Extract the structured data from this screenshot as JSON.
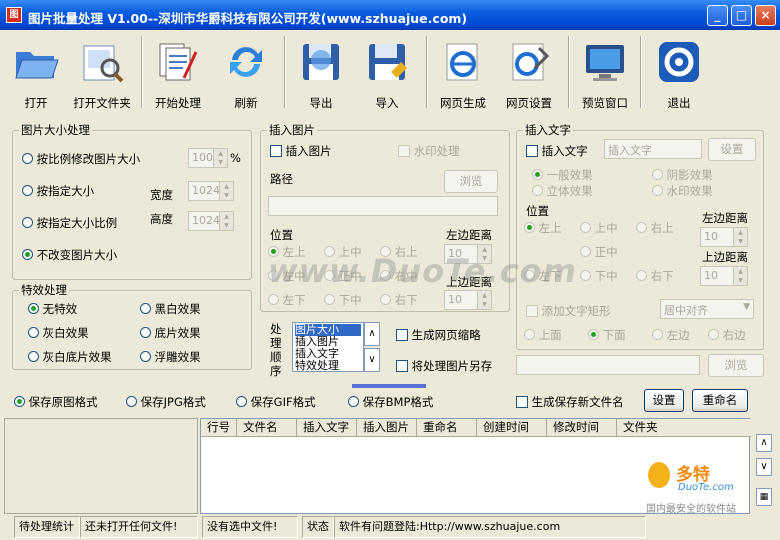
{
  "window": {
    "title": "图片批量处理 V1.00--深圳市华爵科技有限公司开发(www.szhuajue.com)",
    "min": "_",
    "max": "□",
    "close": "×"
  },
  "toolbar": [
    {
      "label": "打开",
      "icon": "open-folder-icon"
    },
    {
      "label": "打开文件夹",
      "icon": "folder-magnifier-icon"
    },
    {
      "label": "开始处理",
      "icon": "process-docs-icon"
    },
    {
      "label": "刷新",
      "icon": "refresh-icon"
    },
    {
      "label": "导出",
      "icon": "floppy-export-icon"
    },
    {
      "label": "导入",
      "icon": "floppy-import-icon"
    },
    {
      "label": "网页生成",
      "icon": "ie-globe-icon"
    },
    {
      "label": "网页设置",
      "icon": "ie-page-icon"
    },
    {
      "label": "预览窗口",
      "icon": "monitor-icon"
    },
    {
      "label": "退出",
      "icon": "exit-icon"
    }
  ],
  "size": {
    "legend": "图片大小处理",
    "opt_ratio": "按比例修改图片大小",
    "ratio_value": "100",
    "pct": "%",
    "opt_size": "按指定大小",
    "width_label": "宽度",
    "width_value": "1024",
    "opt_size_ratio": "按指定大小比例",
    "height_label": "高度",
    "height_value": "1024",
    "opt_keep": "不改变图片大小"
  },
  "effects": {
    "legend": "特效处理",
    "items": [
      "无特效",
      "黑白效果",
      "灰白效果",
      "底片效果",
      "灰白底片效果",
      "浮雕效果"
    ]
  },
  "insert_image": {
    "legend": "插入图片",
    "check_label": "插入图片",
    "watermark_label": "水印处理",
    "path_label": "路径",
    "browse": "浏览",
    "position_label": "位置",
    "pos": [
      "左上",
      "上中",
      "右上",
      "左中",
      "正中",
      "右中",
      "左下",
      "下中",
      "右下"
    ],
    "left_label": "左边距离",
    "left_value": "10",
    "top_label": "上边距离",
    "top_value": "10"
  },
  "insert_text": {
    "legend": "插入文字",
    "check_label": "插入文字",
    "placeholder": "插入文字",
    "settings": "设置",
    "effects": [
      "一般效果",
      "阴影效果",
      "立体效果",
      "水印效果"
    ],
    "position_label": "位置",
    "pos": [
      "左上",
      "上中",
      "右上",
      "正中",
      "左下",
      "下中",
      "右下"
    ],
    "left_label": "左边距离",
    "left_value": "10",
    "top_label": "上边距离",
    "top_value": "10",
    "rect_label": "添加文字矩形",
    "align_value": "居中对齐",
    "rect_pos": [
      "上面",
      "下面",
      "左边",
      "右边"
    ],
    "browse": "浏览"
  },
  "order": {
    "label": "处理顺序",
    "items": [
      "图片大小",
      "插入图片",
      "插入文字",
      "特效处理"
    ],
    "up": "∧",
    "down": "∨",
    "gen_thumb": "生成网页缩略",
    "save_as": "将处理图片另存"
  },
  "formats": {
    "items": [
      "保存原图格式",
      "保存JPG格式",
      "保存GIF格式",
      "保存BMP格式"
    ],
    "gen_name": "生成保存新文件名",
    "settings": "设置",
    "rename": "重命名"
  },
  "table": {
    "columns": [
      "行号",
      "文件名",
      "插入文字",
      "插入图片",
      "重命名",
      "创建时间",
      "修改时间",
      "文件夹"
    ]
  },
  "status": {
    "pending": "待处理统计",
    "no_file": "还未打开任何文件!",
    "no_selection": "没有选中文件!",
    "state_label": "状态",
    "message": "软件有问题登陆:Http://www.szhuajue.com"
  },
  "watermark": {
    "text": "www.DuoTe.com",
    "badge1": "多特",
    "badge2": "DuoTe.com",
    "badge3": "国内最安全的软件站"
  },
  "colors": {
    "title_blue": "#0a5ee0",
    "accent_green": "#21a121"
  }
}
